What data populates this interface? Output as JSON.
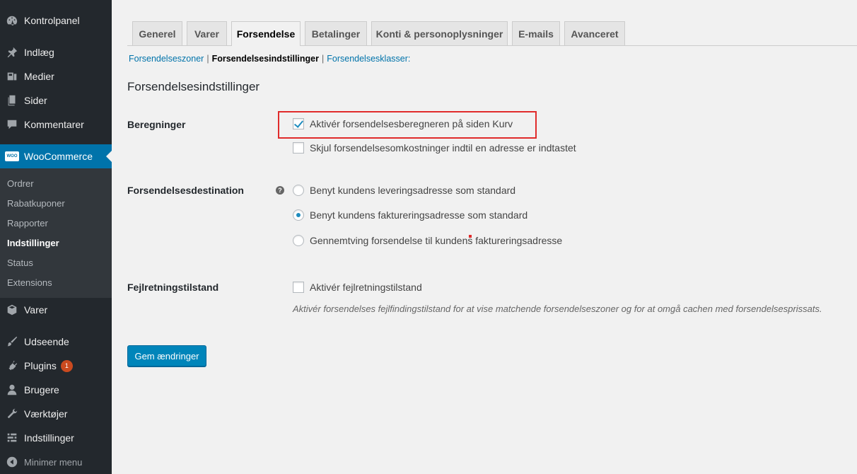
{
  "sidebar": {
    "items": [
      {
        "label": "Kontrolpanel",
        "icon": "dashboard-icon"
      },
      {
        "label": "Indlæg",
        "icon": "pin-icon"
      },
      {
        "label": "Medier",
        "icon": "media-icon"
      },
      {
        "label": "Sider",
        "icon": "pages-icon"
      },
      {
        "label": "Kommentarer",
        "icon": "comment-icon"
      },
      {
        "label": "WooCommerce",
        "icon": "woocommerce-icon"
      },
      {
        "label": "Varer",
        "icon": "box-icon"
      },
      {
        "label": "Udseende",
        "icon": "brush-icon"
      },
      {
        "label": "Plugins",
        "icon": "plugin-icon",
        "badge": "1"
      },
      {
        "label": "Brugere",
        "icon": "user-icon"
      },
      {
        "label": "Værktøjer",
        "icon": "wrench-icon"
      },
      {
        "label": "Indstillinger",
        "icon": "settings-icon"
      },
      {
        "label": "Minimer menu",
        "icon": "collapse-icon"
      }
    ],
    "woo_logo_text": "WOO",
    "submenu": [
      {
        "label": "Ordrer"
      },
      {
        "label": "Rabatkuponer"
      },
      {
        "label": "Rapporter"
      },
      {
        "label": "Indstillinger"
      },
      {
        "label": "Status"
      },
      {
        "label": "Extensions"
      }
    ]
  },
  "tabs": [
    {
      "label": "Generel"
    },
    {
      "label": "Varer"
    },
    {
      "label": "Forsendelse"
    },
    {
      "label": "Betalinger"
    },
    {
      "label": "Konti & personoplysninger"
    },
    {
      "label": "E-mails"
    },
    {
      "label": "Avanceret"
    }
  ],
  "subnav": {
    "zones": "Forsendelseszoner",
    "settings": "Forsendelsesindstillinger",
    "classes": "Forsendelsesklasser:",
    "sep": "|"
  },
  "page": {
    "heading": "Forsendelsesindstillinger"
  },
  "form": {
    "calc_label": "Beregninger",
    "calc_option_1": "Aktivér forsendelsesberegneren på siden Kurv",
    "calc_option_2": "Skjul forsendelsesomkostninger indtil en adresse er indtastet",
    "dest_label": "Forsendelsesdestination",
    "help_glyph": "?",
    "dest_option_1": "Benyt kundens leveringsadresse som standard",
    "dest_option_2": "Benyt kundens faktureringsadresse som standard",
    "dest_option_3": "Gennemtving forsendelse til kundens faktureringsadresse",
    "debug_label": "Fejlretningstilstand",
    "debug_option": "Aktivér fejlretningstilstand",
    "debug_desc": "Aktivér forsendelses fejlfindingstilstand for at vise matchende forsendelseszoner og for at omgå cachen med forsendelsesprissats.",
    "save_label": "Gem ændringer"
  },
  "colors": {
    "sidebar_bg": "#23282d",
    "submenu_bg": "#32373c",
    "accent": "#0073aa",
    "button": "#0085ba",
    "highlight": "#e02b2b"
  }
}
